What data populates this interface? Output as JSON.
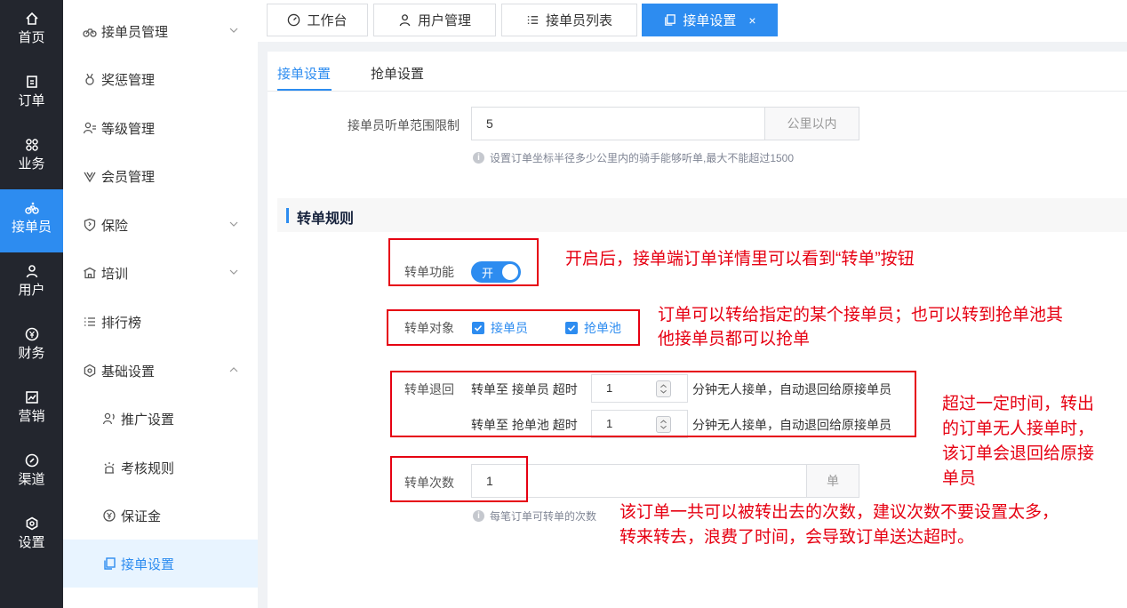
{
  "rail": {
    "items": [
      {
        "label": "首页"
      },
      {
        "label": "订单"
      },
      {
        "label": "业务"
      },
      {
        "label": "接单员"
      },
      {
        "label": "用户"
      },
      {
        "label": "财务"
      },
      {
        "label": "营销"
      },
      {
        "label": "渠道"
      },
      {
        "label": "设置"
      }
    ]
  },
  "subnav": {
    "items": [
      {
        "label": "接单员管理"
      },
      {
        "label": "奖惩管理"
      },
      {
        "label": "等级管理"
      },
      {
        "label": "会员管理"
      },
      {
        "label": "保险"
      },
      {
        "label": "培训"
      },
      {
        "label": "排行榜"
      },
      {
        "label": "基础设置"
      },
      {
        "label": "推广设置"
      },
      {
        "label": "考核规则"
      },
      {
        "label": "保证金"
      },
      {
        "label": "接单设置"
      }
    ]
  },
  "tabs": [
    {
      "label": "工作台"
    },
    {
      "label": "用户管理"
    },
    {
      "label": "接单员列表"
    },
    {
      "label": "接单设置",
      "close": "×"
    }
  ],
  "subtabs": [
    {
      "label": "接单设置"
    },
    {
      "label": "抢单设置"
    }
  ],
  "form": {
    "range": {
      "label": "接单员听单范围限制",
      "value": "5",
      "addon": "公里以内",
      "hint": "设置订单坐标半径多少公里内的骑手能够听单,最大不能超过1500"
    },
    "section_title": "转单规则",
    "transfer_switch": {
      "label": "转单功能",
      "value": "开"
    },
    "transfer_target": {
      "label": "转单对象",
      "options": [
        "接单员",
        "抢单池"
      ]
    },
    "transfer_return": {
      "label": "转单退回",
      "rows": [
        {
          "prefix": "转单至 接单员 超时",
          "value": "1",
          "suffix": "分钟无人接单，自动退回给原接单员"
        },
        {
          "prefix": "转单至 抢单池 超时",
          "value": "1",
          "suffix": "分钟无人接单，自动退回给原接单员"
        }
      ]
    },
    "transfer_count": {
      "label": "转单次数",
      "value": "1",
      "addon": "单",
      "hint": "每笔订单可转单的次数"
    }
  },
  "annotations": {
    "switch_note": "开启后，接单端订单详情里可以看到“转单”按钮",
    "target_note_1": "订单可以转给指定的某个接单员；也可以转到抢单池其",
    "target_note_2": "他接单员都可以抢单",
    "return_note_1": "超过一定时间，转出",
    "return_note_2": "的订单无人接单时，",
    "return_note_3": "该订单会退回给原接",
    "return_note_4": "单员",
    "count_note_1": "该订单一共可以被转出去的次数，建议次数不要设置太多，",
    "count_note_2": "转来转去，浪费了时间，会导致订单送达超时。"
  },
  "colors": {
    "primary": "#2d8cf0",
    "rail_bg": "#23262e",
    "annotation": "#e60012"
  }
}
